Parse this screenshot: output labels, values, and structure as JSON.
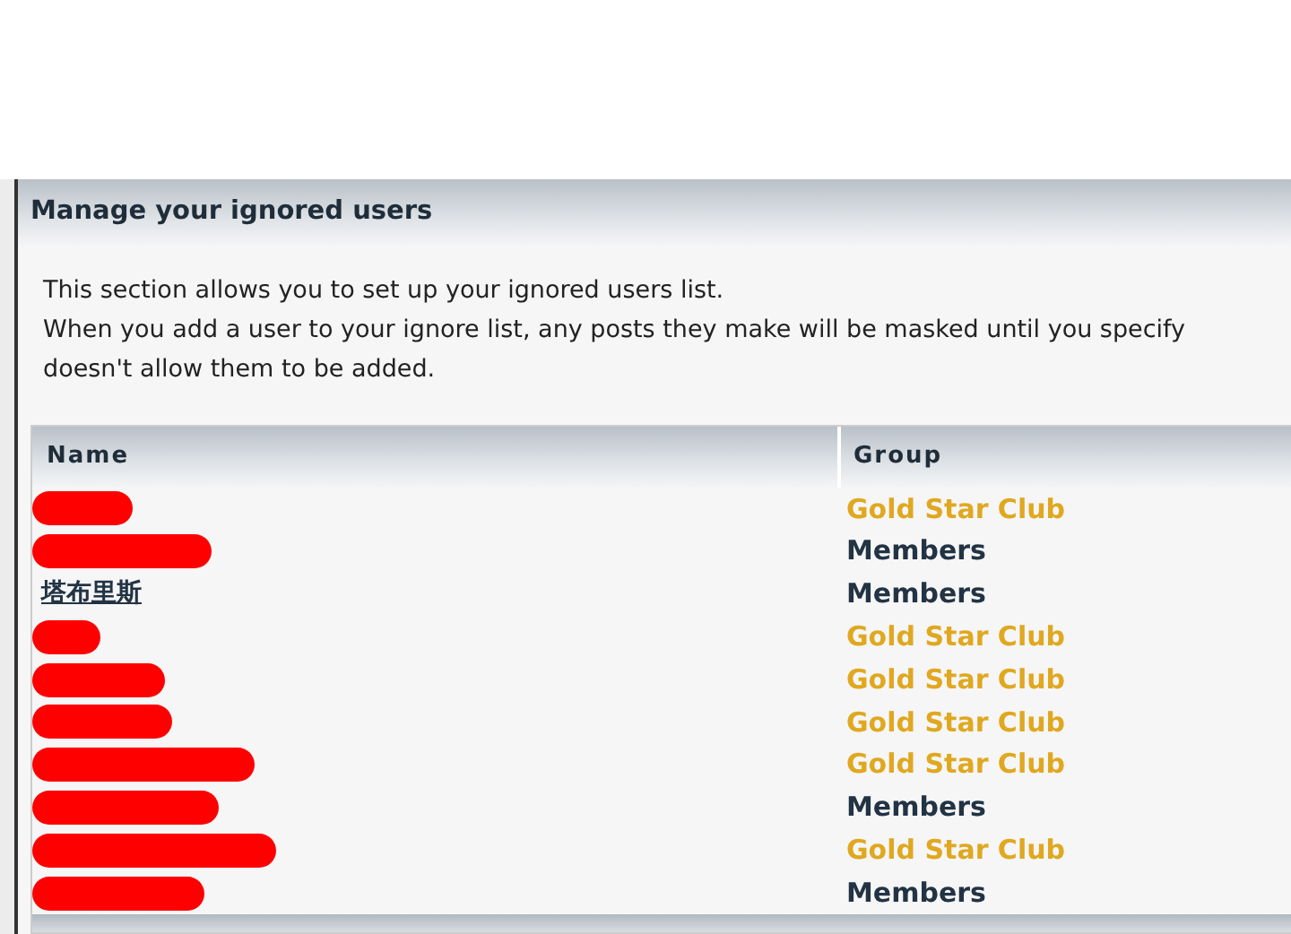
{
  "panel": {
    "title": "Manage your ignored users",
    "description": [
      "This section allows you to set up your ignored users list.",
      "When you add a user to your ignore list, any posts they make will be masked until you specify",
      "doesn't allow them to be added."
    ]
  },
  "table": {
    "columns": [
      "Name",
      "Group"
    ],
    "rows": [
      {
        "kind": "redacted",
        "group": "Gold Star Club",
        "color": "#e0a820"
      },
      {
        "kind": "redacted",
        "group": "Members",
        "color": "#223344"
      },
      {
        "kind": "name",
        "name": "塔布里斯",
        "group": "Members",
        "color": "#223344"
      },
      {
        "kind": "redacted",
        "group": "Gold Star Club",
        "color": "#e0a820"
      },
      {
        "kind": "redacted",
        "group": "Gold Star Club",
        "color": "#e0a820"
      },
      {
        "kind": "redacted",
        "group": "Gold Star Club",
        "color": "#e0a820"
      },
      {
        "kind": "redacted",
        "group": "Gold Star Club",
        "color": "#e0a820"
      },
      {
        "kind": "redacted",
        "group": "Members",
        "color": "#223344"
      },
      {
        "kind": "redacted",
        "group": "Gold Star Club",
        "color": "#e0a820"
      },
      {
        "kind": "redacted",
        "group": "Members",
        "color": "#223344"
      }
    ]
  }
}
